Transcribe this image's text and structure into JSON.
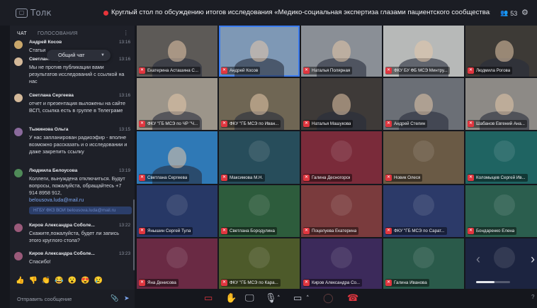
{
  "app": {
    "logo": "Толк",
    "title": "Круглый стол по обсуждению итогов исследования «Медико-социальная экспертиза глазами пациентского сообщества»",
    "participants_count": "53",
    "recording_color": "#e8343a"
  },
  "sidebar": {
    "tabs": [
      "ЧАТ",
      "ГОЛОСОВАНИЯ"
    ],
    "chat_selector": "Общий чат",
    "messages": [
      {
        "author": "Андрей Косов",
        "time": "13:16",
        "text": "Статьи",
        "avatar_color": "#c9a76b"
      },
      {
        "author": "Светлана Сергеева",
        "time": "13:16",
        "text": "Мы не против публикации вами результатов исследований с ссылкой на нас",
        "avatar_color": "#d4b99a"
      },
      {
        "author": "Светлана Сергеева",
        "time": "13:16",
        "text": "отчет и презентация выложены на сайте ВСП, ссылка есть в группе в Телеграме",
        "avatar_color": "#d4b99a"
      },
      {
        "author": "Тыжинова Ольга",
        "time": "13:15",
        "text": "У нас запланирован радиоэфир - вполне возможно рассказать и о исследовании и даже закрепить ссылку",
        "avatar_color": "#8a6a9c"
      },
      {
        "author": "Людмила Белоусова",
        "time": "13:19",
        "text": "Коллеги, вынуждена отключиться. Будут вопросы, пожалуйста, обращайтесь +7 914 8958 912,",
        "link": "belousova.luda@mail.ru",
        "file": "НГБУ ФКЗ ВОИ belousova.luda@mail.ru",
        "avatar_color": "#4f8a58"
      },
      {
        "author": "Киров Александра Соболе...",
        "time": "13:22",
        "text": "Скажите,пожалуйста, будет ли запись этого круглого стола?",
        "avatar_color": "#9a5a7a"
      },
      {
        "author": "Киров Александра Соболе...",
        "time": "13:23",
        "text": "Спасибо!",
        "avatar_color": "#9a5a7a"
      }
    ],
    "reactions": [
      "👍",
      "👎",
      "👏",
      "😂",
      "😮",
      "😍",
      "😢"
    ],
    "composer_placeholder": "Отправить сообщение"
  },
  "tiles": [
    {
      "name": "Екатерина Асташина С...",
      "bg": "#5d5a57",
      "video": true
    },
    {
      "name": "Андрей Косов",
      "bg": "#7e98b5",
      "video": true,
      "speaking": true
    },
    {
      "name": "Наталья Полярная",
      "bg": "#8a8f96",
      "video": true
    },
    {
      "name": "ФКУ БУ ФБ МСЭ Минтру...",
      "bg": "#b7b9b8",
      "video": true
    },
    {
      "name": "Людмила Рогова",
      "bg": "#3d3a36",
      "video": true
    },
    {
      "name": "ФКУ \"ГБ МСЭ по ЧР \"Ч...",
      "bg": "#9c958a",
      "video": true
    },
    {
      "name": "ФКУ \"ГБ МСЭ по Иван...",
      "bg": "#6f6654",
      "video": true
    },
    {
      "name": "Наталья Машукова",
      "bg": "#3e3a38",
      "video": true
    },
    {
      "name": "Андрей Стелин",
      "bg": "#6b6f76",
      "video": true
    },
    {
      "name": "Шабанов Евгений Ана...",
      "bg": "#8d8a86",
      "video": true
    },
    {
      "name": "Светлана Сергеева",
      "bg": "#2f79b6",
      "video": true
    },
    {
      "name": "Максимова М.Н.",
      "bg": "#274d5b",
      "video": false
    },
    {
      "name": "Галина Десногорск",
      "bg": "#7a2b3a",
      "video": false
    },
    {
      "name": "Новик Олеся",
      "bg": "#6a5a45",
      "video": false
    },
    {
      "name": "Коломыцев Сергей Ив...",
      "bg": "#1f6462",
      "video": false
    },
    {
      "name": "Янышин Сергей Тула",
      "bg": "#273866",
      "video": false
    },
    {
      "name": "Светлана Бородулина",
      "bg": "#2d5c3c",
      "video": false
    },
    {
      "name": "Поцелуева Екатерина",
      "bg": "#7a3b3d",
      "video": false
    },
    {
      "name": "ФКУ \"ГБ МСЭ по Сарат...",
      "bg": "#2c3a69",
      "video": false
    },
    {
      "name": "Бондаренко Елена",
      "bg": "#2b5e4e",
      "video": false
    },
    {
      "name": "Яна Денисова",
      "bg": "#6a2a44",
      "video": false
    },
    {
      "name": "ФКУ \"ГБ МСЭ по Кара...",
      "bg": "#4d5a2a",
      "video": false
    },
    {
      "name": "Киров Александра Со...",
      "bg": "#3c2a5b",
      "video": false
    },
    {
      "name": "Галина Иванова",
      "bg": "#2a5a4a",
      "video": false
    },
    {
      "name": "",
      "bg": "#1c2440",
      "video": false
    }
  ],
  "controls": {
    "icons": [
      "chat-icon",
      "raise-hand-icon",
      "screen-share-icon",
      "microphone-icon",
      "camera-icon",
      "end-call-icon"
    ],
    "accent": "#e0363f"
  }
}
